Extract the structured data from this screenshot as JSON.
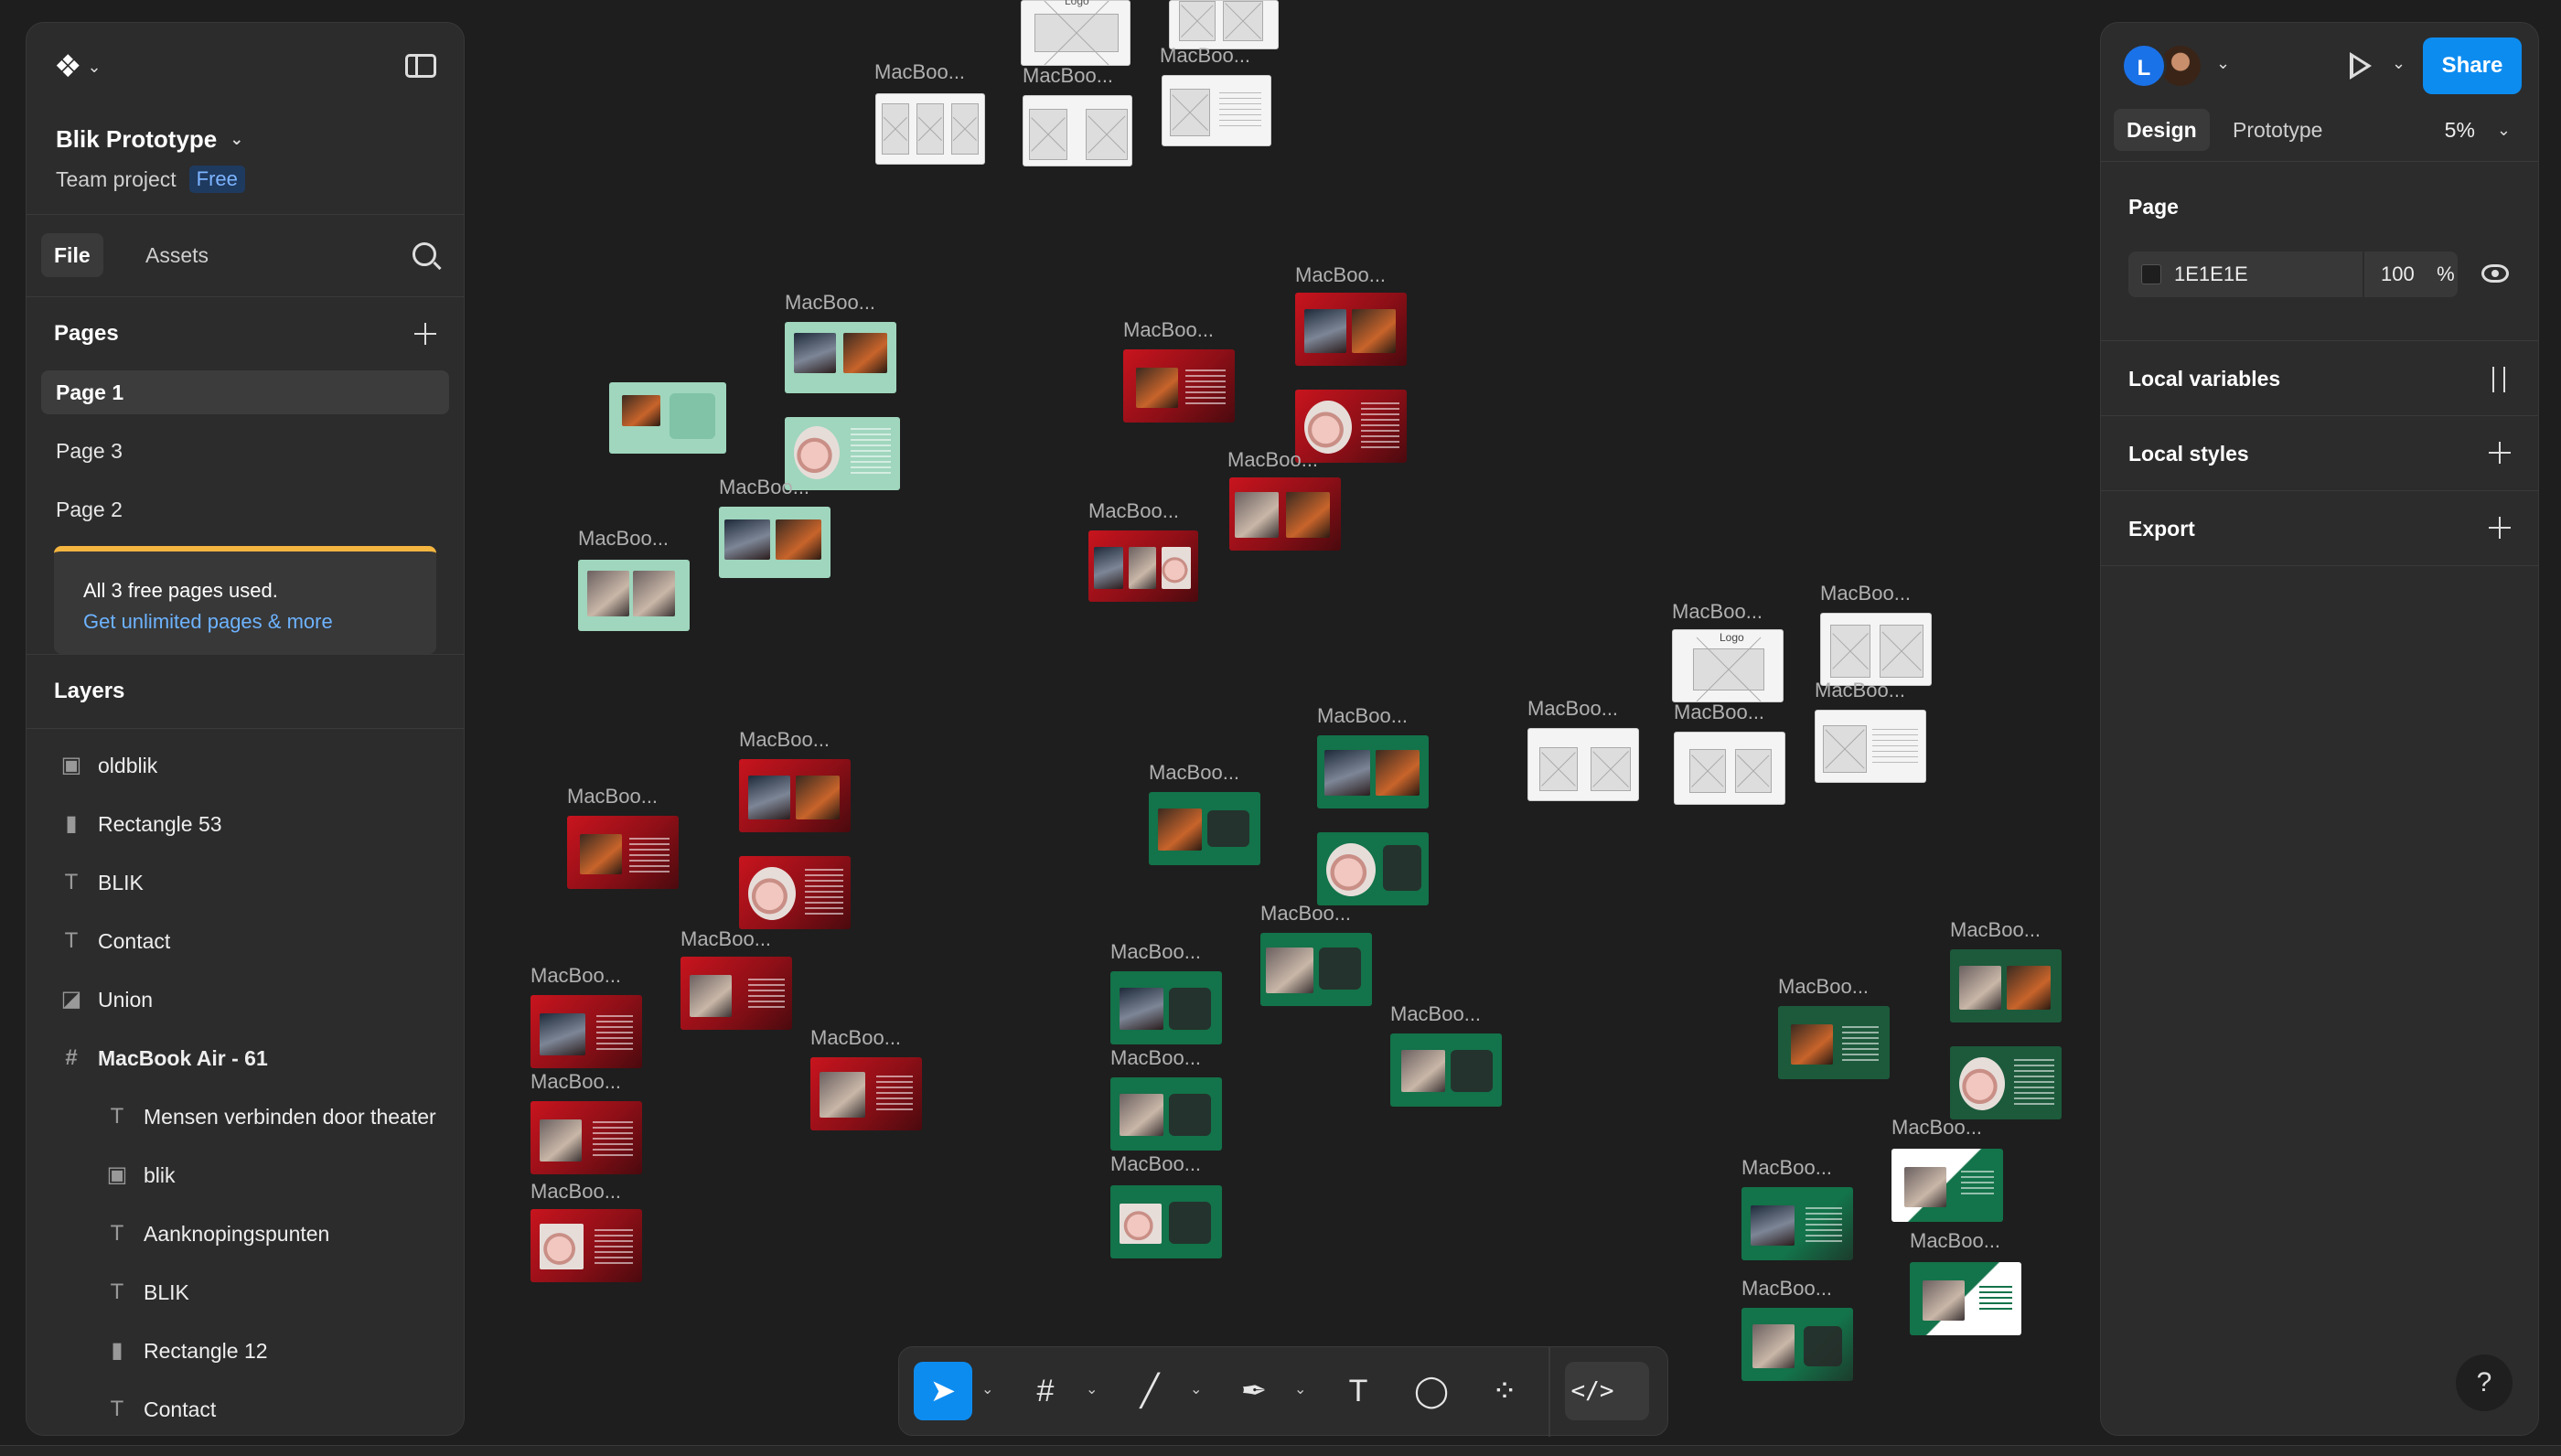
{
  "canvas": {
    "frame_label": "MacBoo...",
    "logo_text": "Logo",
    "background": "#1E1E1E"
  },
  "file": {
    "name": "Blik Prototype",
    "team": "Team project",
    "plan_badge": "Free"
  },
  "left_tabs": {
    "file": "File",
    "assets": "Assets"
  },
  "pages": {
    "title": "Pages",
    "items": [
      {
        "label": "Page 1",
        "active": true
      },
      {
        "label": "Page 3",
        "active": false
      },
      {
        "label": "Page 2",
        "active": false
      }
    ],
    "limit_notice": "All 3 free pages used.",
    "upgrade_link": "Get unlimited pages & more"
  },
  "layers": {
    "title": "Layers",
    "items": [
      {
        "label": "oldblik",
        "icon": "image-icon",
        "child": false
      },
      {
        "label": "Rectangle 53",
        "icon": "rectangle-icon",
        "child": false
      },
      {
        "label": "BLIK",
        "icon": "text-icon",
        "child": false
      },
      {
        "label": "Contact",
        "icon": "text-icon",
        "child": false
      },
      {
        "label": "Union",
        "icon": "union-icon",
        "child": false
      },
      {
        "label": "MacBook Air - 61",
        "icon": "frame-icon",
        "child": false
      },
      {
        "label": "Mensen verbinden door theater",
        "icon": "text-icon",
        "child": true
      },
      {
        "label": "blik",
        "icon": "image-icon",
        "child": true
      },
      {
        "label": "Aanknopingspunten",
        "icon": "text-icon",
        "child": true
      },
      {
        "label": "BLIK",
        "icon": "text-icon",
        "child": true
      },
      {
        "label": "Rectangle 12",
        "icon": "rectangle-icon",
        "child": true
      },
      {
        "label": "Contact",
        "icon": "text-icon",
        "child": true
      }
    ]
  },
  "header": {
    "avatar_initial": "L",
    "share_label": "Share",
    "tab_design": "Design",
    "tab_prototype": "Prototype",
    "zoom": "5%"
  },
  "inspector": {
    "page_title": "Page",
    "page_color_hex": "1E1E1E",
    "page_opacity": "100",
    "opacity_unit": "%",
    "local_variables": "Local variables",
    "local_styles": "Local styles",
    "export": "Export"
  },
  "toolbar": {
    "tools": [
      "move-tool",
      "frame-tool",
      "line-tool",
      "pen-tool",
      "text-tool",
      "comment-tool",
      "actions-tool"
    ],
    "dev_mode_label": "</>"
  },
  "help_label": "?"
}
